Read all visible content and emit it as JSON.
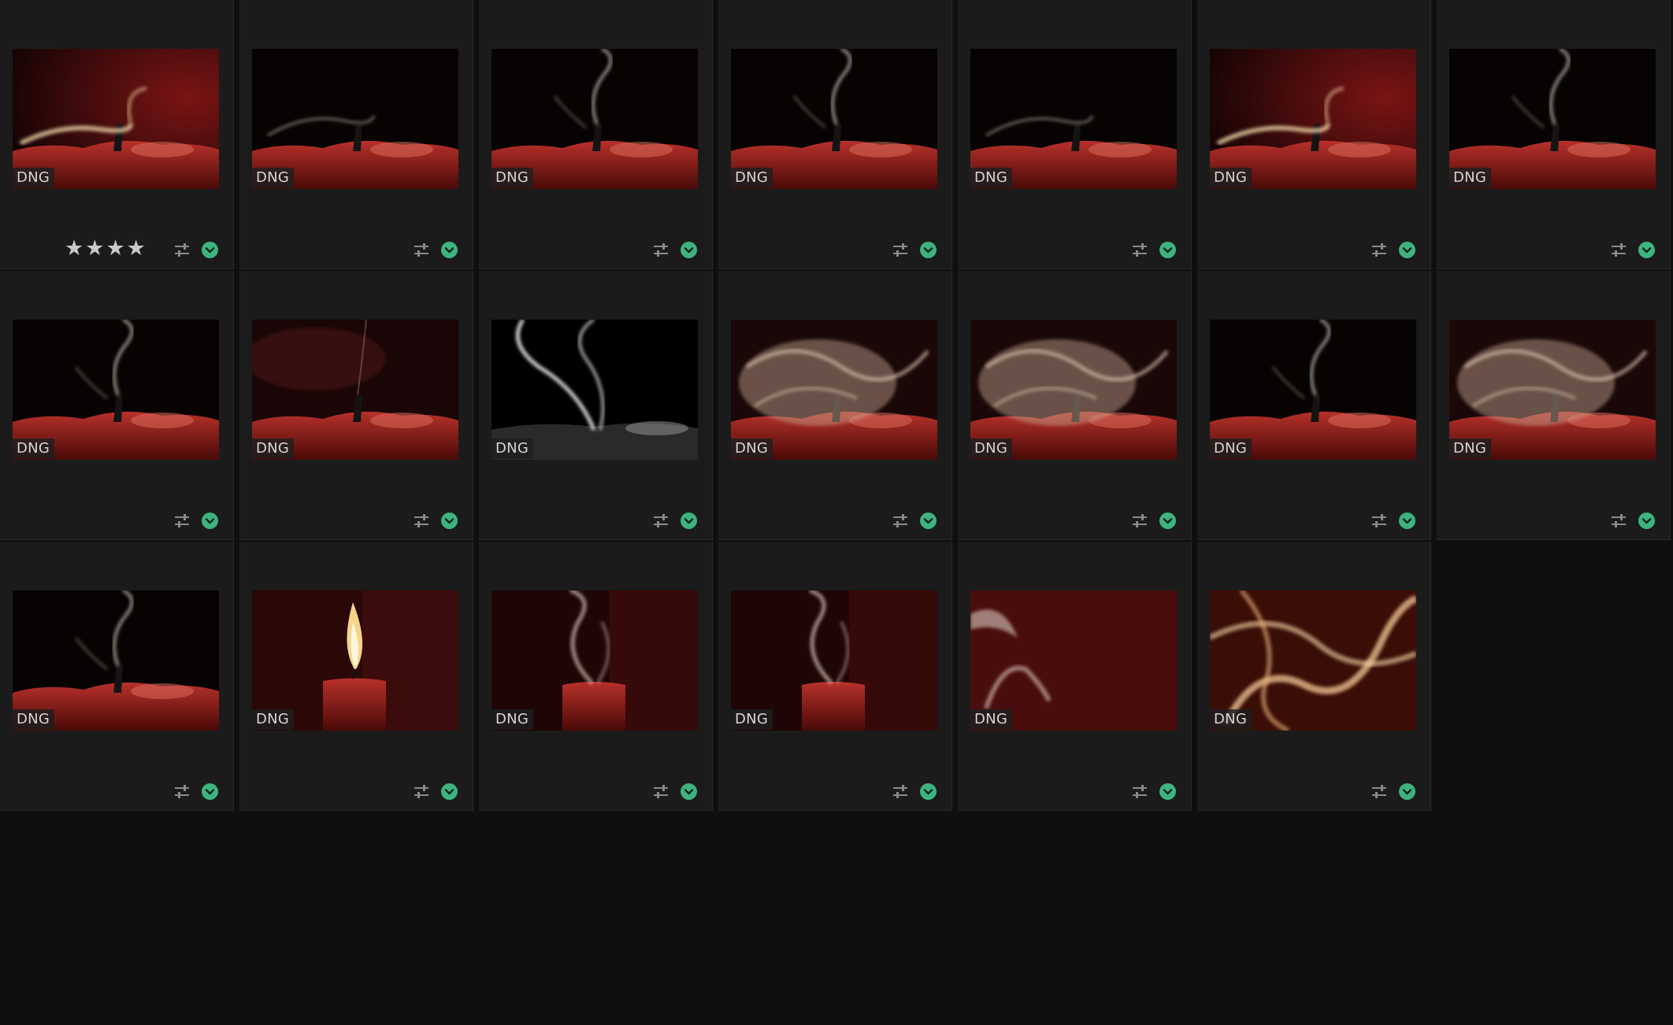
{
  "grid": {
    "columns": 7,
    "photos": [
      {
        "format": "DNG",
        "rating": 4,
        "scene": "flame-warm"
      },
      {
        "format": "DNG",
        "rating": 0,
        "scene": "dark-wisp"
      },
      {
        "format": "DNG",
        "rating": 0,
        "scene": "dark-smoke-up"
      },
      {
        "format": "DNG",
        "rating": 0,
        "scene": "dark-smoke-up"
      },
      {
        "format": "DNG",
        "rating": 0,
        "scene": "dark-wisp"
      },
      {
        "format": "DNG",
        "rating": 0,
        "scene": "flame-warm"
      },
      {
        "format": "DNG",
        "rating": 0,
        "scene": "dark-smoke-up"
      },
      {
        "format": "DNG",
        "rating": 0,
        "scene": "dark-smoke-up"
      },
      {
        "format": "DNG",
        "rating": 0,
        "scene": "dark-red-haze"
      },
      {
        "format": "DNG",
        "rating": 0,
        "scene": "bw-smoke"
      },
      {
        "format": "DNG",
        "rating": 0,
        "scene": "smoke-cloud"
      },
      {
        "format": "DNG",
        "rating": 0,
        "scene": "smoke-cloud"
      },
      {
        "format": "DNG",
        "rating": 0,
        "scene": "dark-smoke-up"
      },
      {
        "format": "DNG",
        "rating": 0,
        "scene": "smoke-cloud"
      },
      {
        "format": "DNG",
        "rating": 0,
        "scene": "dark-smoke-up"
      },
      {
        "format": "DNG",
        "rating": 0,
        "scene": "lit-candle"
      },
      {
        "format": "DNG",
        "rating": 0,
        "scene": "candle-smoke"
      },
      {
        "format": "DNG",
        "rating": 0,
        "scene": "candle-smoke"
      },
      {
        "format": "DNG",
        "rating": 0,
        "scene": "red-wall-smoke"
      },
      {
        "format": "DNG",
        "rating": 0,
        "scene": "orange-smoke"
      }
    ],
    "icons": {
      "adjust": "sliders-icon",
      "picked": "checkmark-circle-icon",
      "star": "star-icon"
    },
    "colors": {
      "background": "#0f0f0f",
      "cell": "#1b1b1b",
      "picked_green": "#3fb37f",
      "star": "#c9c9c9"
    }
  }
}
